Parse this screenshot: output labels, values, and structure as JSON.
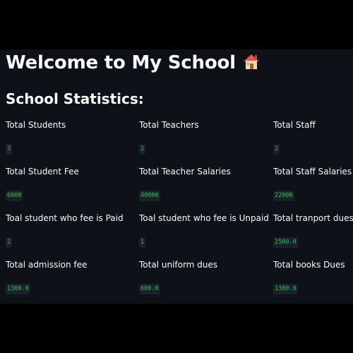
{
  "page": {
    "title": "Welcome to My School",
    "title_icon": "house-icon",
    "section_title": "School Statistics:"
  },
  "colors": {
    "background": "#0e1117",
    "text": "#fafafa",
    "value_text": "#21c354",
    "value_bg": "#1c2129"
  },
  "stats": [
    {
      "label": "Total Students",
      "value": "3"
    },
    {
      "label": "Total Teachers",
      "value": "2"
    },
    {
      "label": "Total Staff",
      "value": "2"
    },
    {
      "label": "Total Student Fee",
      "value": "6000"
    },
    {
      "label": "Total Teacher Salaries",
      "value": "40000"
    },
    {
      "label": "Total Staff Salaries",
      "value": "22000"
    },
    {
      "label": "Toal student who fee is Paid",
      "value": "2"
    },
    {
      "label": "Toal student who fee is Unpaid",
      "value": "1"
    },
    {
      "label": "Total tranport dues",
      "value": "2500.0"
    },
    {
      "label": "Total admission fee",
      "value": "1300.0"
    },
    {
      "label": "Total uniform dues",
      "value": "600.0"
    },
    {
      "label": "Total books Dues",
      "value": "1300.0"
    }
  ]
}
